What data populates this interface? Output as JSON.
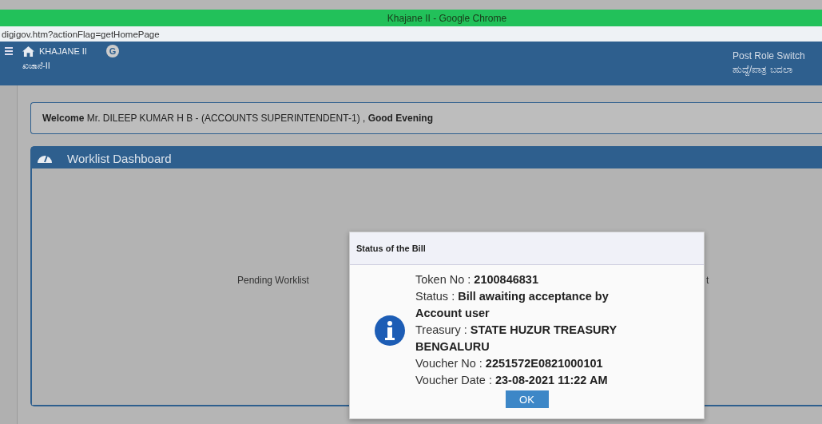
{
  "window": {
    "title": "Khajane II - Google Chrome"
  },
  "address_bar": {
    "url": "digigov.htm?actionFlag=getHomePage"
  },
  "header": {
    "app_name": "KHAJANE II",
    "app_name_local": "ಖಜಾನೆ-II",
    "badge": "G",
    "role_switch": "Post Role Switch",
    "role_switch_local": "ಹುದ್ದೆ/ಪಾತ್ರ ಬದಲಾ"
  },
  "welcome": "**Welcome** Mr. DILEEP KUMAR H B - (ACCOUNTS SUPERINTENDENT-1) , **Good Evening**",
  "panel": {
    "title": "Worklist Dashboard",
    "message_left": "Pending Worklist",
    "message_right": "t"
  },
  "dialog": {
    "title": "Status of the Bill",
    "lines": [
      "Token No : **2100846831**",
      "Status : **Bill awaiting acceptance by Account user**",
      "Treasury : **STATE HUZUR TREASURY BENGALURU**",
      "Voucher No : **2251572E0821000101**",
      "Voucher Date : **23-08-2021 11:22 AM**"
    ],
    "button": "OK"
  }
}
